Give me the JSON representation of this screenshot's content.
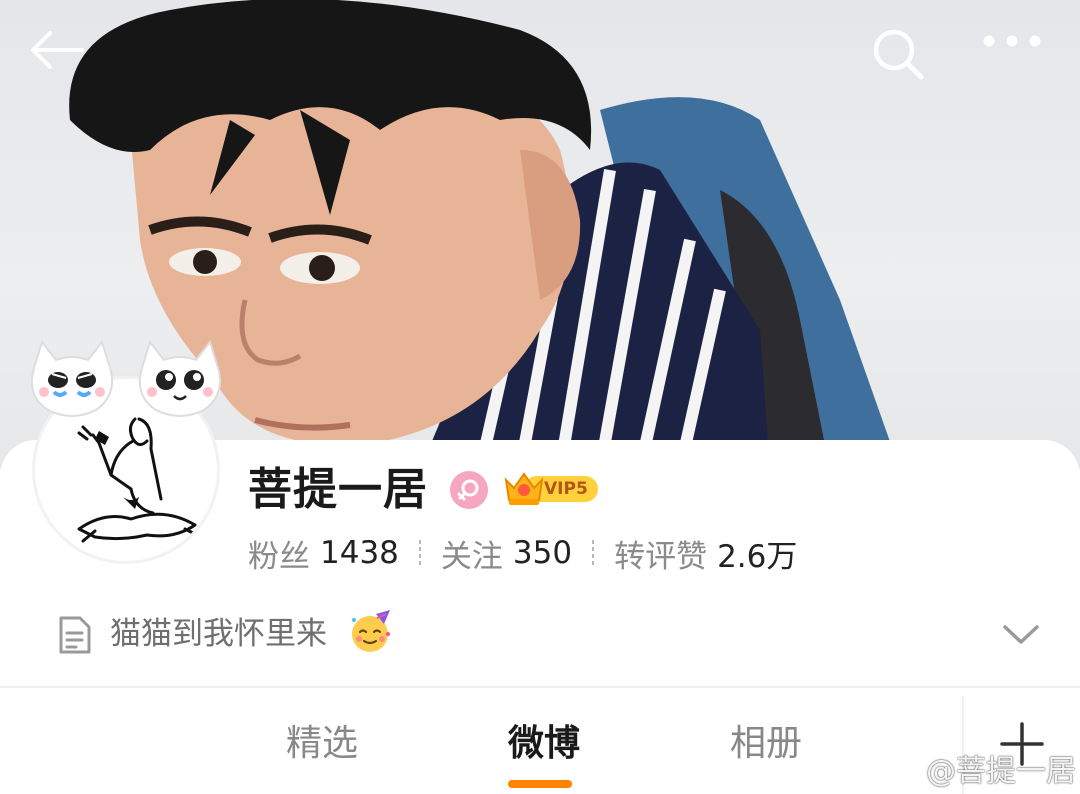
{
  "header": {
    "back_icon": "arrow-left-icon",
    "search_icon": "search-icon",
    "more_icon": "more-horizontal-icon"
  },
  "profile": {
    "name": "菩提一居",
    "gender_icon": "female-icon",
    "vip_label": "VIP5",
    "stats": [
      {
        "label": "粉丝",
        "value": "1438"
      },
      {
        "label": "关注",
        "value": "350"
      },
      {
        "label": "转评赞",
        "value": "2.6万"
      }
    ],
    "bio": "猫猫到我怀里来",
    "bio_emoji": "partying-face-emoji",
    "expand_icon": "chevron-down-icon"
  },
  "tabs": [
    {
      "label": "精选",
      "active": false
    },
    {
      "label": "微博",
      "active": true
    },
    {
      "label": "相册",
      "active": false
    }
  ],
  "add_tab_icon": "plus-icon",
  "watermark": "@菩提一居",
  "colors": {
    "accent": "#ff8200",
    "vip_gold": "#ffd23c",
    "gender_pink": "#f6a6c0",
    "muted_text": "#8a8a8a"
  }
}
